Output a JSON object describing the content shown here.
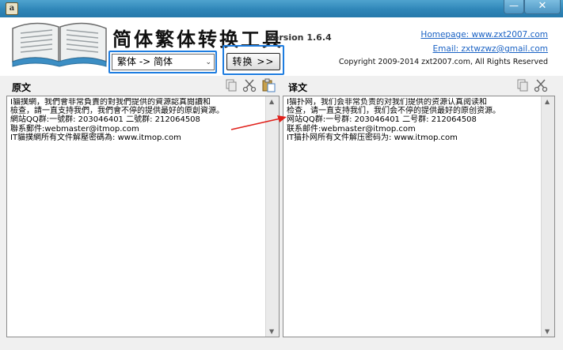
{
  "window": {
    "app_icon_glyph": "a",
    "minimize_glyph": "—",
    "close_glyph": "✕"
  },
  "header": {
    "title": "简体繁体转换工具",
    "version": "Version 1.6.4",
    "homepage_link": "Homepage: www.zxt2007.com",
    "email_link": "Email: zxtwzwz@gmail.com",
    "copyright": "Copyright 2009-2014 zxt2007.com, All Rights Reserved"
  },
  "controls": {
    "direction_select_value": "繁体 -> 简体",
    "convert_button": "转换 >>"
  },
  "source_panel": {
    "label": "原文",
    "text": "I貓撲網，我們會非常負責的對我們提供的資源認真閱讀和\n檢查，請一直支持我們，我們會不停的提供最好的原創資源。\n網站QQ群:一號群: 203046401 二號群: 212064508\n聯系郵件:webmaster@itmop.com\nIT貓撲網所有文件解壓密碼為: www.itmop.com"
  },
  "result_panel": {
    "label": "译文",
    "text": "I猫扑网，我们会非常负责的对我们提供的资源认真阅读和\n检查，请一直支持我们，我们会不停的提供最好的原创资源。\n网站QQ群:一号群: 203046401 二号群: 212064508\n联系邮件:webmaster@itmop.com\nIT猫扑网所有文件解压密码为: www.itmop.com"
  },
  "icons": [
    "book-logo-icon",
    "copy-icon",
    "cut-icon",
    "paste-icon",
    "red-arrow-icon"
  ],
  "colors": {
    "titlebar": "#2f86b8",
    "highlight_frame": "#1e7de0",
    "link": "#1a62c4",
    "annotation_arrow": "#e0201a"
  }
}
